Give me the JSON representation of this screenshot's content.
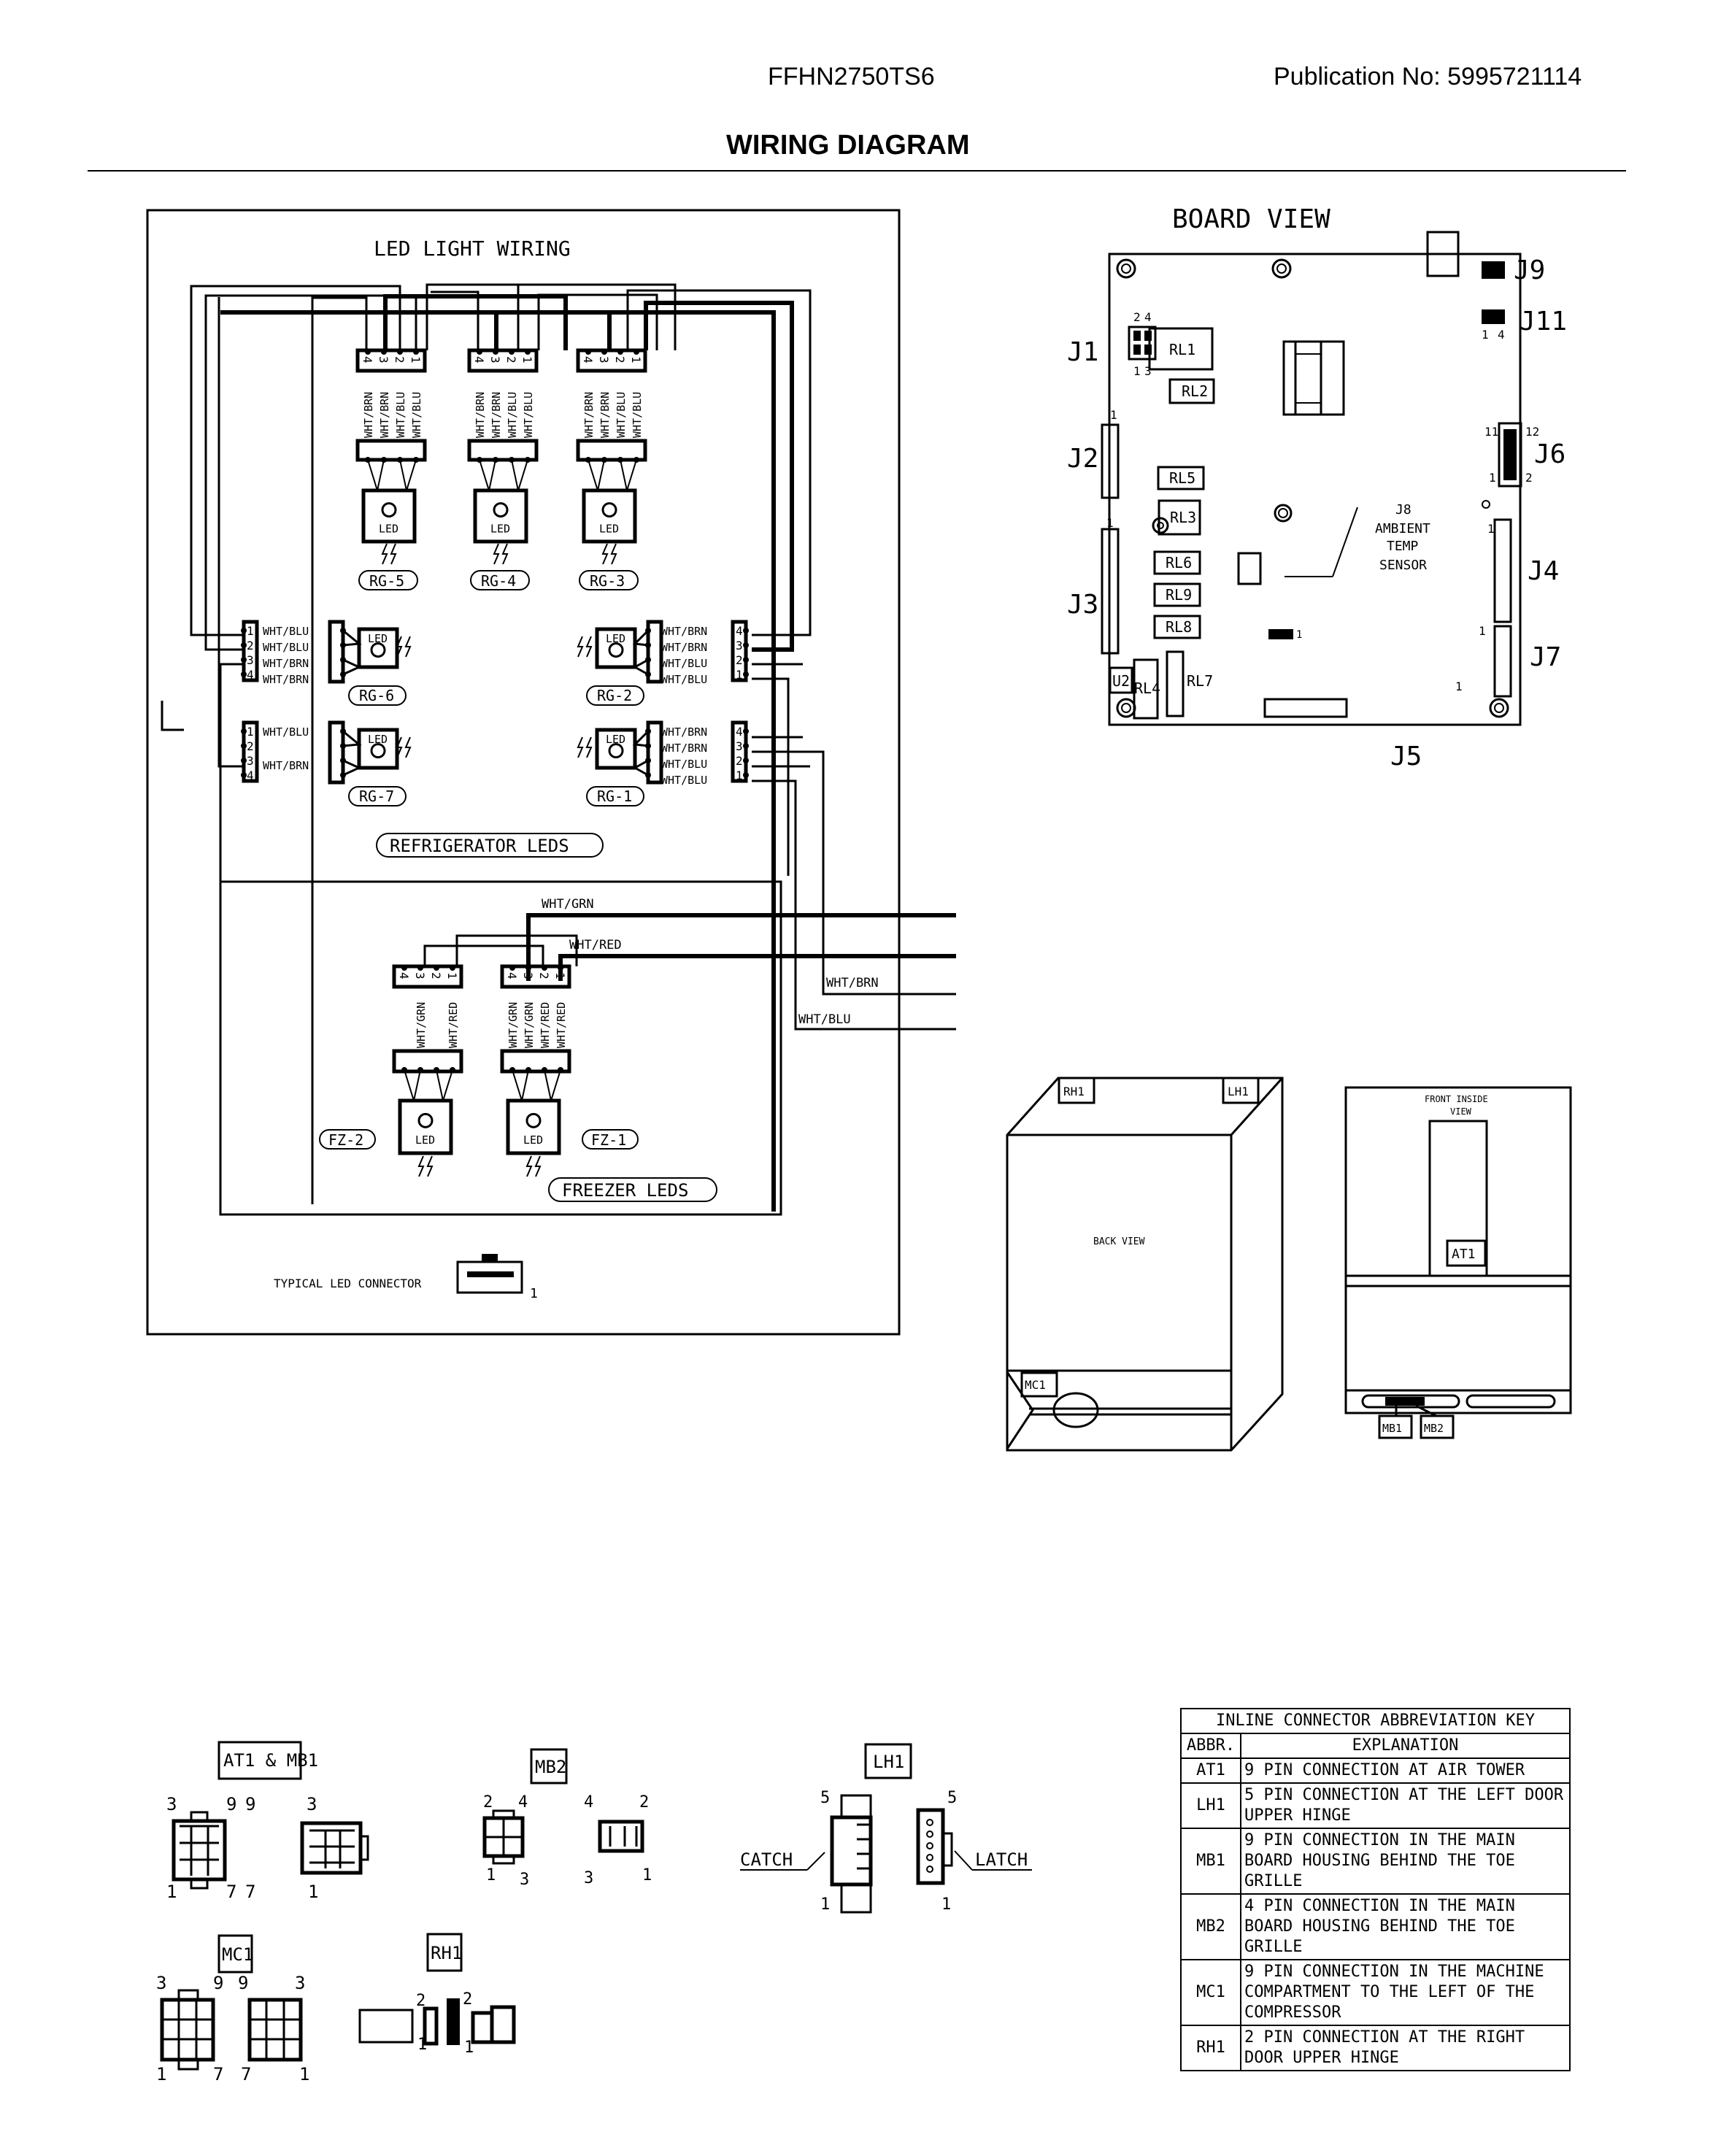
{
  "header": {
    "model": "FFHN2750TS6",
    "publication": "Publication No:  5995721114",
    "title": "WIRING DIAGRAM"
  },
  "led_section": {
    "title": "LED LIGHT WIRING",
    "pin_numbers": [
      "4",
      "3",
      "2",
      "1"
    ],
    "upper_wire_labels": [
      "WHT/BRN",
      "WHT/BRN",
      "WHT/BLU",
      "WHT/BLU"
    ],
    "led_text": "LED",
    "upper_leds": [
      "RG-5",
      "RG-4",
      "RG-3"
    ],
    "left_leds": [
      {
        "id": "RG-6",
        "pins": [
          "1",
          "2",
          "3",
          "4"
        ],
        "wires": [
          "WHT/BLU",
          "WHT/BLU",
          "WHT/BRN",
          "WHT/BRN"
        ]
      },
      {
        "id": "RG-7",
        "pins": [
          "1",
          "2",
          "3",
          "4"
        ],
        "wires": [
          "WHT/BLU",
          "WHT/BRN"
        ]
      }
    ],
    "right_leds": [
      {
        "id": "RG-2",
        "pins": [
          "4",
          "3",
          "2",
          "1"
        ],
        "wires": [
          "WHT/BRN",
          "WHT/BRN",
          "WHT/BLU",
          "WHT/BLU"
        ]
      },
      {
        "id": "RG-1",
        "pins": [
          "4",
          "3",
          "2",
          "1"
        ],
        "wires": [
          "WHT/BRN",
          "WHT/BRN",
          "WHT/BLU",
          "WHT/BLU"
        ]
      }
    ],
    "refrigerator_label": "REFRIGERATOR LEDS",
    "freezer_label": "FREEZER LEDS",
    "freezer_leds": [
      {
        "id": "FZ-2",
        "wires": [
          "WHT/GRN",
          "WHT/RED"
        ]
      },
      {
        "id": "FZ-1",
        "wires": [
          "WHT/GRN",
          "WHT/GRN",
          "WHT/RED",
          "WHT/RED"
        ]
      }
    ],
    "outgoing_wires": [
      "WHT/GRN",
      "WHT/RED",
      "WHT/BRN",
      "WHT/BLU"
    ],
    "typical_connector_label": "TYPICAL LED CONNECTOR",
    "typical_connector_pin": "1"
  },
  "board_view": {
    "title": "BOARD VIEW",
    "connectors": [
      "J1",
      "J2",
      "J3",
      "J4",
      "J5",
      "J6",
      "J7",
      "J9",
      "J11"
    ],
    "relays": [
      "RL1",
      "RL2",
      "RL3",
      "RL4",
      "RL5",
      "RL6",
      "RL7",
      "RL8",
      "RL9"
    ],
    "u2": "U2",
    "j1_pins": [
      "2",
      "4",
      "1",
      "3"
    ],
    "j11_pins": [
      "1",
      "4"
    ],
    "j6_pins": [
      "11",
      "12",
      "1",
      "2"
    ],
    "pin_one": "1",
    "sensor_label": [
      "J8",
      "AMBIENT",
      "TEMP",
      "SENSOR"
    ]
  },
  "back_view": {
    "label": "BACK VIEW",
    "tags": [
      "RH1",
      "LH1",
      "MC1"
    ]
  },
  "front_view": {
    "label": [
      "FRONT INSIDE",
      "VIEW"
    ],
    "tags": [
      "AT1",
      "MB1",
      "MB2"
    ]
  },
  "connector_details": {
    "at1_mb1": {
      "label": "AT1 & MB1",
      "pins": [
        "3",
        "9",
        "1",
        "7",
        "9",
        "3",
        "7",
        "1"
      ]
    },
    "mb2": {
      "label": "MB2",
      "pins": [
        "2",
        "4",
        "1",
        "3",
        "4",
        "2",
        "3",
        "1"
      ]
    },
    "lh1": {
      "label": "LH1",
      "pins": [
        "5",
        "1",
        "5",
        "1"
      ],
      "catch": "CATCH",
      "latch": "LATCH"
    },
    "mc1": {
      "label": "MC1",
      "pins": [
        "3",
        "9",
        "1",
        "7",
        "9",
        "3",
        "7",
        "1"
      ]
    },
    "rh1": {
      "label": "RH1",
      "pins": [
        "2",
        "1",
        "2",
        "1"
      ]
    }
  },
  "abbreviation_key": {
    "title": "INLINE CONNECTOR ABBREVIATION KEY",
    "col_abbr": "ABBR.",
    "col_expl": "EXPLANATION",
    "rows": [
      {
        "abbr": "AT1",
        "text": "9 PIN CONNECTION AT AIR TOWER"
      },
      {
        "abbr": "LH1",
        "text": "5 PIN CONNECTION AT THE LEFT DOOR UPPER HINGE"
      },
      {
        "abbr": "MB1",
        "text": "9 PIN CONNECTION IN THE MAIN BOARD HOUSING BEHIND THE TOE GRILLE"
      },
      {
        "abbr": "MB2",
        "text": "4 PIN CONNECTION IN THE MAIN BOARD HOUSING BEHIND THE TOE GRILLE"
      },
      {
        "abbr": "MC1",
        "text": "9 PIN CONNECTION IN THE MACHINE COMPARTMENT TO THE LEFT OF THE COMPRESSOR"
      },
      {
        "abbr": "RH1",
        "text": "2 PIN CONNECTION AT THE RIGHT DOOR UPPER HINGE"
      }
    ]
  }
}
